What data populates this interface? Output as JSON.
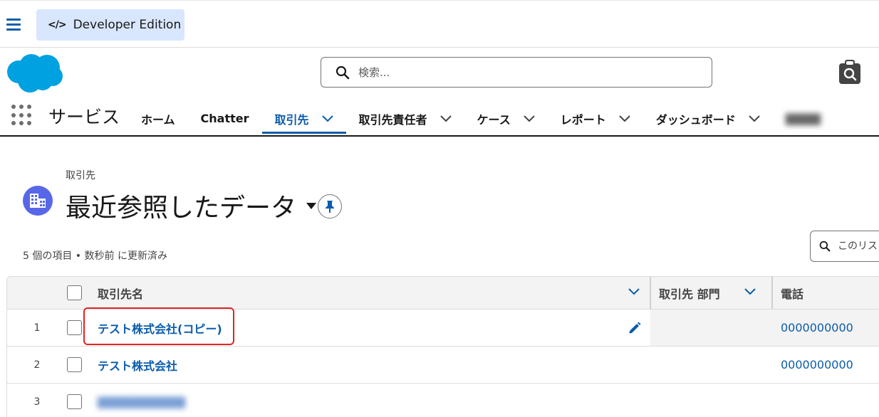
{
  "topbar": {
    "edition_label": "Developer Edition",
    "edition_icon": "code-icon"
  },
  "header": {
    "search_placeholder": "検索...",
    "app_name": "サービス"
  },
  "nav": {
    "items": [
      {
        "label": "ホーム",
        "active": false,
        "has_menu": false
      },
      {
        "label": "Chatter",
        "active": false,
        "has_menu": false
      },
      {
        "label": "取引先",
        "active": true,
        "has_menu": true
      },
      {
        "label": "取引先責任者",
        "active": false,
        "has_menu": true
      },
      {
        "label": "ケース",
        "active": false,
        "has_menu": true
      },
      {
        "label": "レポート",
        "active": false,
        "has_menu": true
      },
      {
        "label": "ダッシュボード",
        "active": false,
        "has_menu": true
      }
    ]
  },
  "list": {
    "object_label": "取引先",
    "view_title": "最近参照したデータ",
    "count_line": "5 個の項目 • 数秒前 に更新済み",
    "search_placeholder": "このリス"
  },
  "table": {
    "columns": [
      "取引先名",
      "取引先 部門",
      "電話"
    ],
    "rows": [
      {
        "num": "1",
        "name": "テスト株式会社(コピー)",
        "dept": "",
        "phone": "0000000000"
      },
      {
        "num": "2",
        "name": "テスト株式会社",
        "dept": "",
        "phone": "0000000000"
      },
      {
        "num": "3",
        "name": "",
        "dept": "",
        "phone": ""
      }
    ]
  },
  "colors": {
    "brand_blue": "#0b5cab",
    "salesforce_cloud": "#00a1e0",
    "account_icon_bg": "#5867e8",
    "highlight_red": "#e02424",
    "edition_badge_bg": "#d8e6fe"
  }
}
